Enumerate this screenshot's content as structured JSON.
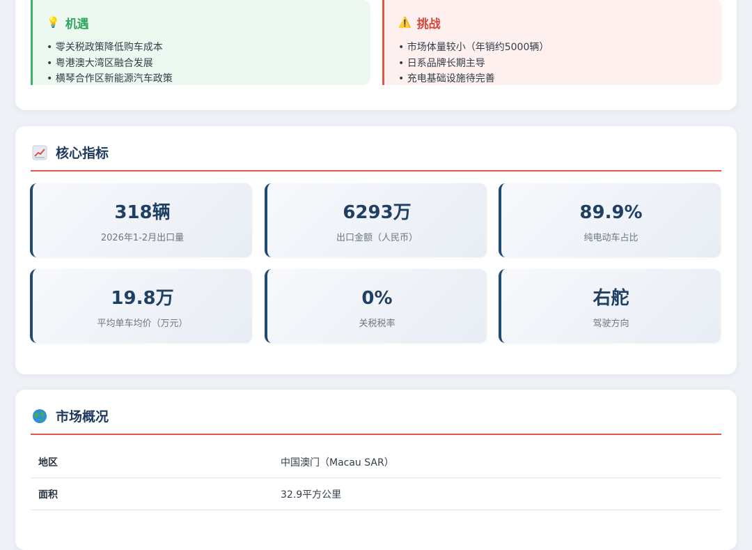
{
  "opportunity": {
    "title": "机遇",
    "icon": "lightbulb-icon",
    "items": [
      "零关税政策降低购车成本",
      "粤港澳大湾区融合发展",
      "横琴合作区新能源汽车政策"
    ]
  },
  "challenge": {
    "title": "挑战",
    "icon": "warning-icon",
    "items": [
      "市场体量较小（年销约5000辆）",
      "日系品牌长期主导",
      "充电基础设施待完善"
    ]
  },
  "metrics_section": {
    "title": "核心指标",
    "icon": "chart-icon",
    "items": [
      {
        "value": "318辆",
        "label": "2026年1-2月出口量"
      },
      {
        "value": "6293万",
        "label": "出口金额（人民币）"
      },
      {
        "value": "89.9%",
        "label": "纯电动车占比"
      },
      {
        "value": "19.8万",
        "label": "平均单车均价（万元）"
      },
      {
        "value": "0%",
        "label": "关税税率"
      },
      {
        "value": "右舵",
        "label": "驾驶方向"
      }
    ]
  },
  "market_section": {
    "title": "市场概况",
    "icon": "globe-icon",
    "rows": [
      {
        "key": "地区",
        "value": "中国澳门（Macau SAR）"
      },
      {
        "key": "面积",
        "value": "32.9平方公里"
      }
    ]
  },
  "colors": {
    "accent_line": "#e0574a",
    "opportunity": "#3bb56a",
    "challenge": "#dd5a4c",
    "metric_accent": "#1f4a72"
  }
}
